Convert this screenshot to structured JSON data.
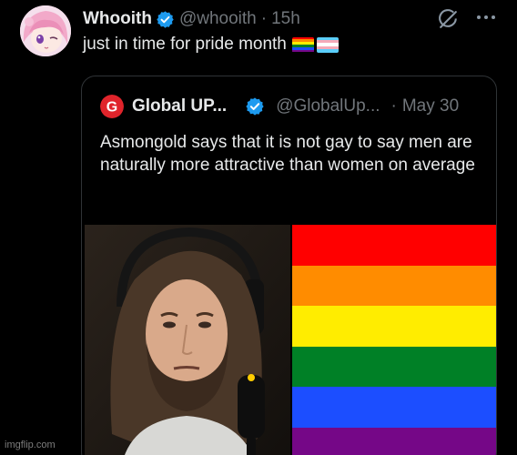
{
  "tweet": {
    "author_name": "Whooith",
    "author_handle": "@whooith",
    "separator": "·",
    "time": "15h",
    "text": "just in time for pride month",
    "emojis": [
      "rainbow-flag",
      "transgender-flag"
    ]
  },
  "quote": {
    "author_name": "Global UP...",
    "author_handle": "@GlobalUp...",
    "separator": "·",
    "date": "May 30",
    "logo_letter": "G",
    "text": "Asmongold says that it is not gay to say men are naturally more attractive than women on average",
    "flag_colors": [
      "#ff0000",
      "#ff8c00",
      "#ffed00",
      "#008026",
      "#1c4eff",
      "#750787"
    ]
  },
  "icons": {
    "verified": "verified-badge-icon",
    "grok": "grok-icon",
    "more": "more-icon"
  },
  "colors": {
    "background": "#000000",
    "text": "#e7e9ea",
    "secondary": "#71767b",
    "verified_blue": "#1d9bf0",
    "border": "#2f3336"
  },
  "watermark": "imgflip.com"
}
